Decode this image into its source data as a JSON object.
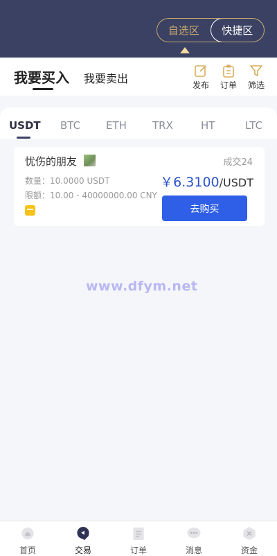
{
  "zones": {
    "watchlist": "自选区",
    "quick": "快捷区"
  },
  "trade_tabs": {
    "buy": "我要买入",
    "sell": "我要卖出"
  },
  "tools": [
    {
      "label": "发布",
      "icon": "edit-icon"
    },
    {
      "label": "订单",
      "icon": "clipboard-icon"
    },
    {
      "label": "筛选",
      "icon": "filter-icon"
    }
  ],
  "currencies": [
    "USDT",
    "BTC",
    "ETH",
    "TRX",
    "HT",
    "LTC"
  ],
  "selected_currency": "USDT",
  "offer": {
    "merchant": "忧伤的朋友",
    "trades": "成交24",
    "quantity": "数量：10.0000 USDT",
    "limit": "限额：10.00 - 40000000.00 CNY",
    "price": "￥6.3100",
    "price_unit": "/USDT",
    "buy_button": "去购买"
  },
  "watermark": "www.dfym.net",
  "nav": [
    {
      "label": "首页",
      "icon": "home-icon"
    },
    {
      "label": "交易",
      "icon": "trade-icon"
    },
    {
      "label": "订单",
      "icon": "orders-icon"
    },
    {
      "label": "消息",
      "icon": "message-icon"
    },
    {
      "label": "资金",
      "icon": "wallet-icon"
    }
  ],
  "active_nav": "交易",
  "colors": {
    "banner": "#3b4163",
    "gold": "#c9a96e",
    "price": "#2a52c8",
    "button": "#2e5fe6"
  }
}
